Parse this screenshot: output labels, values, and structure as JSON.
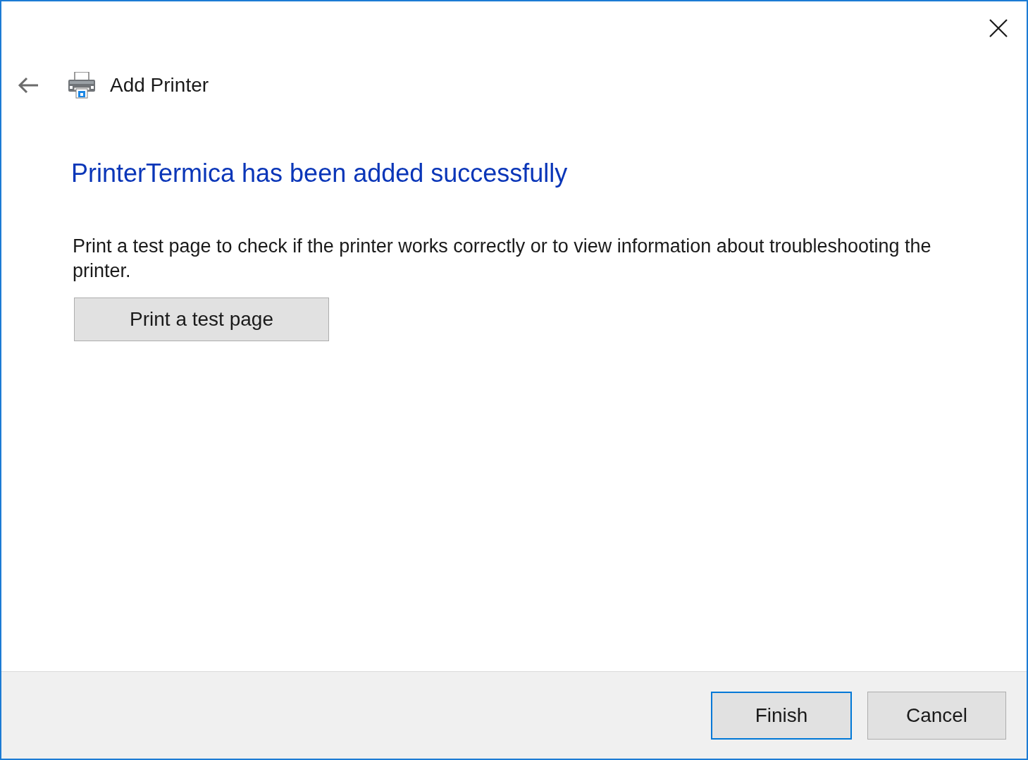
{
  "window": {
    "title": "Add Printer"
  },
  "heading": "PrinterTermica has been added successfully",
  "description": "Print a test page to check if the printer works correctly or to view information about troubleshooting the printer.",
  "test_page_button": {
    "label": "Print a test page"
  },
  "footer_buttons": [
    {
      "label": "Finish",
      "default": true
    },
    {
      "label": "Cancel",
      "default": false
    }
  ]
}
